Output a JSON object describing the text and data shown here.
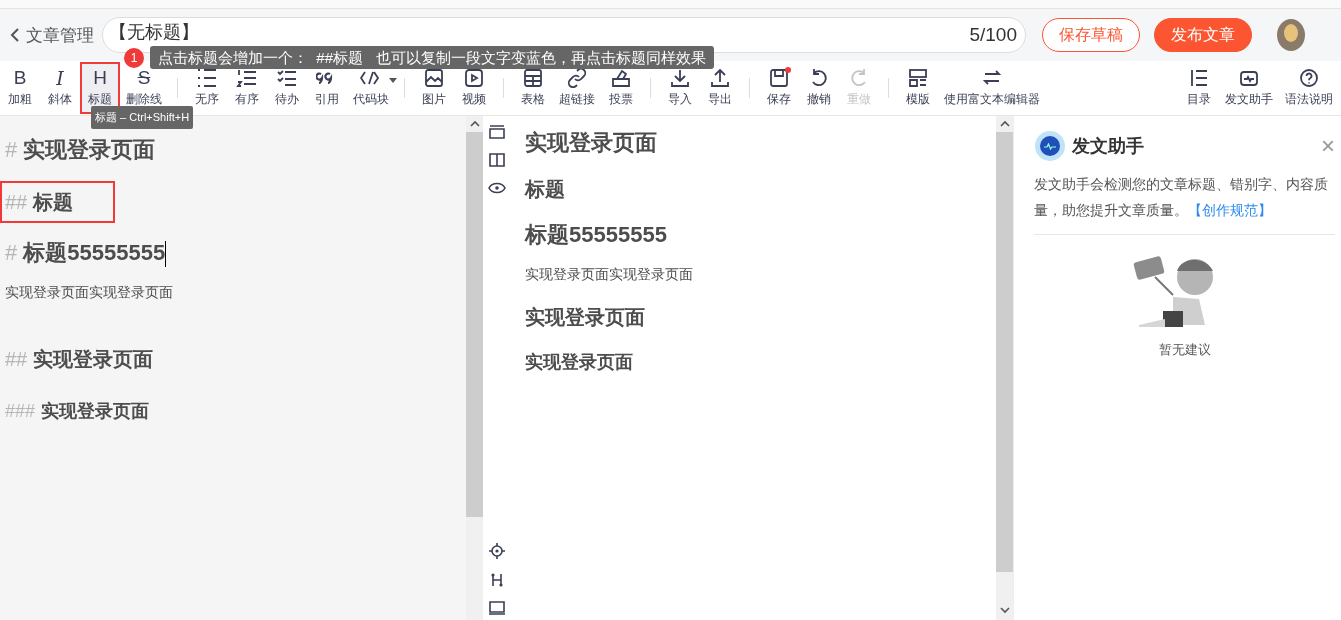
{
  "header": {
    "back_label": "文章管理",
    "title_value": "【无标题】",
    "counter": "5/100",
    "buttons": [
      {
        "label": "保存草稿",
        "kind": "outline"
      },
      {
        "label": "发布文章",
        "kind": "primary"
      }
    ]
  },
  "tooltip": {
    "badge": "1",
    "text": "点击标题会增加一个：  ##标题   也可以复制一段文字变蓝色，再点击标题同样效果"
  },
  "shortcut_tooltip": "标题 – Ctrl+Shift+H",
  "toolbar": {
    "groups": [
      [
        {
          "label": "加粗",
          "glyph": "B",
          "selected": false,
          "annotated": false,
          "disabled": false,
          "dot": false
        },
        {
          "label": "斜体",
          "glyph": "I",
          "selected": false,
          "annotated": false,
          "disabled": false,
          "dot": false
        },
        {
          "label": "标题",
          "glyph": "H",
          "selected": true,
          "annotated": true,
          "disabled": false,
          "dot": false
        },
        {
          "label": "删除线",
          "glyph": "S",
          "selected": false,
          "annotated": false,
          "disabled": false,
          "dot": false
        }
      ],
      [
        {
          "label": "无序",
          "selected": false,
          "annotated": false,
          "disabled": false,
          "dot": false
        },
        {
          "label": "有序",
          "selected": false,
          "annotated": false,
          "disabled": false,
          "dot": false
        },
        {
          "label": "待办",
          "selected": false,
          "annotated": false,
          "disabled": false,
          "dot": false
        },
        {
          "label": "引用",
          "selected": false,
          "annotated": false,
          "disabled": false,
          "dot": false
        },
        {
          "label": "代码块",
          "selected": false,
          "annotated": false,
          "disabled": false,
          "dot": false
        }
      ],
      [
        {
          "label": "图片",
          "selected": false,
          "annotated": false,
          "disabled": false,
          "dot": false
        },
        {
          "label": "视频",
          "selected": false,
          "annotated": false,
          "disabled": false,
          "dot": false
        }
      ],
      [
        {
          "label": "表格",
          "selected": false,
          "annotated": false,
          "disabled": false,
          "dot": false
        },
        {
          "label": "超链接",
          "selected": false,
          "annotated": false,
          "disabled": false,
          "dot": false
        },
        {
          "label": "投票",
          "selected": false,
          "annotated": false,
          "disabled": false,
          "dot": false
        }
      ],
      [
        {
          "label": "导入",
          "selected": false,
          "annotated": false,
          "disabled": false,
          "dot": false
        },
        {
          "label": "导出",
          "selected": false,
          "annotated": false,
          "disabled": false,
          "dot": false
        }
      ],
      [
        {
          "label": "保存",
          "selected": false,
          "annotated": false,
          "disabled": false,
          "dot": true
        },
        {
          "label": "撤销",
          "selected": false,
          "annotated": false,
          "disabled": false,
          "dot": false
        },
        {
          "label": "重做",
          "selected": false,
          "annotated": false,
          "disabled": true,
          "dot": false
        }
      ],
      [
        {
          "label": "模版",
          "selected": false,
          "annotated": false,
          "disabled": false,
          "dot": false
        },
        {
          "label": "使用富文本编辑器",
          "selected": false,
          "annotated": false,
          "disabled": false,
          "dot": false
        }
      ]
    ],
    "right": [
      {
        "label": "目录"
      },
      {
        "label": "发文助手"
      },
      {
        "label": "语法说明"
      }
    ]
  },
  "editor": {
    "lines": [
      {
        "kind": "h1",
        "marker": "#",
        "text": "实现登录页面",
        "annotated": false,
        "cursor": false
      },
      {
        "kind": "h2",
        "marker": "##",
        "text": "标题",
        "annotated": true,
        "cursor": false
      },
      {
        "kind": "h1",
        "marker": "#",
        "text": "标题55555555",
        "annotated": false,
        "cursor": true
      },
      {
        "kind": "p",
        "text": "实现登录页面实现登录页面",
        "annotated": false,
        "cursor": false
      },
      {
        "kind": "h2",
        "marker": "##",
        "text": "实现登录页面",
        "annotated": false,
        "cursor": false
      },
      {
        "kind": "h3",
        "marker": "###",
        "text": "实现登录页面",
        "annotated": false,
        "cursor": false
      }
    ]
  },
  "preview": {
    "lines": [
      {
        "kind": "h1",
        "text": "实现登录页面"
      },
      {
        "kind": "h2",
        "text": "标题"
      },
      {
        "kind": "h1",
        "text": "标题55555555"
      },
      {
        "kind": "p",
        "text": "实现登录页面实现登录页面"
      },
      {
        "kind": "h2",
        "text": "实现登录页面"
      },
      {
        "kind": "h3",
        "text": "实现登录页面"
      }
    ]
  },
  "assistant": {
    "title": "发文助手",
    "close": "×",
    "description": "发文助手会检测您的文章标题、错别字、内容质量，助您提升文章质量。",
    "link": "【创作规范】",
    "empty_text": "暂无建议"
  }
}
